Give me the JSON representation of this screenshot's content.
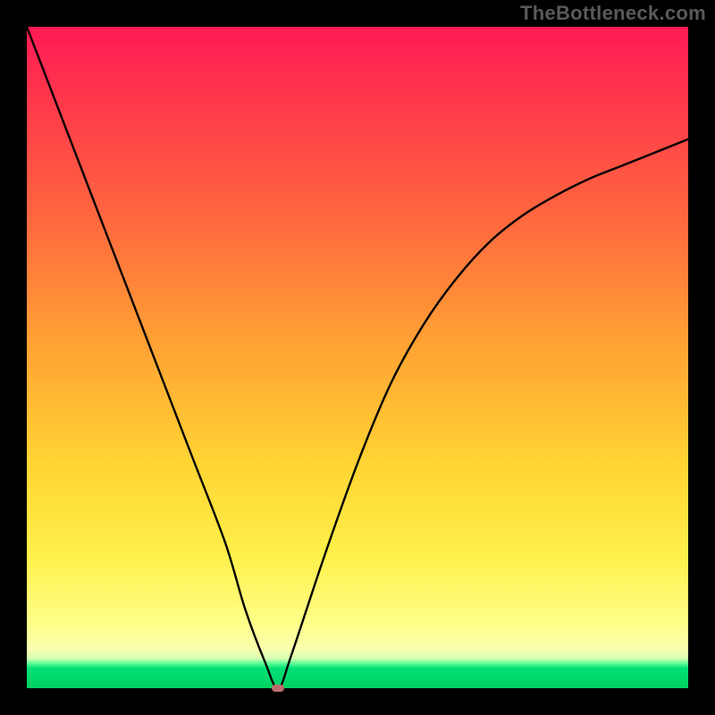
{
  "watermark": "TheBottleneck.com",
  "chart_data": {
    "type": "line",
    "title": "",
    "xlabel": "",
    "ylabel": "",
    "xlim": [
      0,
      100
    ],
    "ylim": [
      0,
      100
    ],
    "grid": false,
    "legend": null,
    "gradient_bands": [
      {
        "at_pct": 0,
        "color": "#ff1a55"
      },
      {
        "at_pct": 30,
        "color": "#ff6a3e"
      },
      {
        "at_pct": 66,
        "color": "#ffd433"
      },
      {
        "at_pct": 90,
        "color": "#ffff88"
      },
      {
        "at_pct": 97,
        "color": "#00e077"
      },
      {
        "at_pct": 100,
        "color": "#00d060"
      }
    ],
    "series": [
      {
        "name": "bottleneck-curve",
        "x": [
          0,
          5,
          10,
          15,
          20,
          25,
          30,
          33,
          36,
          38,
          40,
          45,
          50,
          55,
          60,
          65,
          70,
          75,
          80,
          85,
          90,
          95,
          100
        ],
        "y": [
          100,
          87,
          74,
          61,
          48,
          35,
          22,
          12,
          4,
          0,
          5,
          20,
          34,
          46,
          55,
          62,
          67.5,
          71.5,
          74.5,
          77,
          79,
          81,
          83
        ]
      }
    ],
    "min_point": {
      "x": 38,
      "y": 0
    },
    "annotations": []
  }
}
